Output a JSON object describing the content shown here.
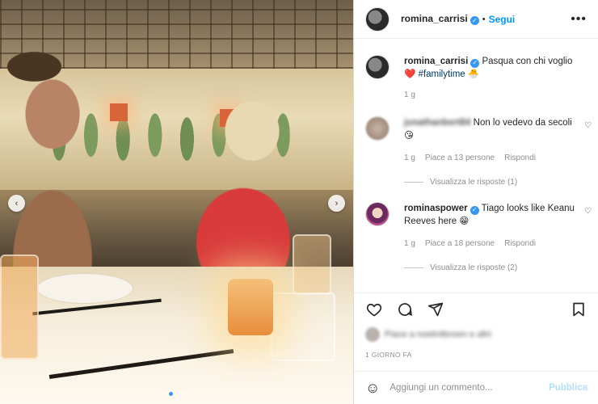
{
  "header": {
    "username": "romina_carrisi",
    "separator": "•",
    "follow_label": "Segui",
    "more_label": "•••"
  },
  "caption": {
    "username": "romina_carrisi",
    "text": "Pasqua con chi voglio",
    "emoji_heart": "❤️",
    "hashtag": "#familytime",
    "emoji_end": "🐣",
    "time": "1 g"
  },
  "comments": [
    {
      "username": "jonathanbert84",
      "text": "Non lo vedevo da secoli",
      "emoji": "😘",
      "time": "1 g",
      "likes": "Piace a 13 persone",
      "reply_label": "Rispondi",
      "view_replies": "Visualizza le risposte (1)"
    },
    {
      "username": "rominaspower",
      "text": "Tiago looks like Keanu Reeves here",
      "emoji": "😁",
      "time": "1 g",
      "likes": "Piace a 18 persone",
      "reply_label": "Rispondi",
      "view_replies": "Visualizza le risposte (2)"
    }
  ],
  "likes_summary": "Piace a noelmlbrown e altri",
  "date": "1 GIORNO FA",
  "add_comment": {
    "placeholder": "Aggiungi un commento...",
    "publish_label": "Pubblica"
  },
  "carousel": {
    "prev": "‹",
    "next": "›",
    "total": 4,
    "active_index": 1
  },
  "colors": {
    "accent": "#0095f6",
    "verified": "#3897f0",
    "hashtag": "#00376b",
    "publish_disabled": "#b2dffc"
  }
}
